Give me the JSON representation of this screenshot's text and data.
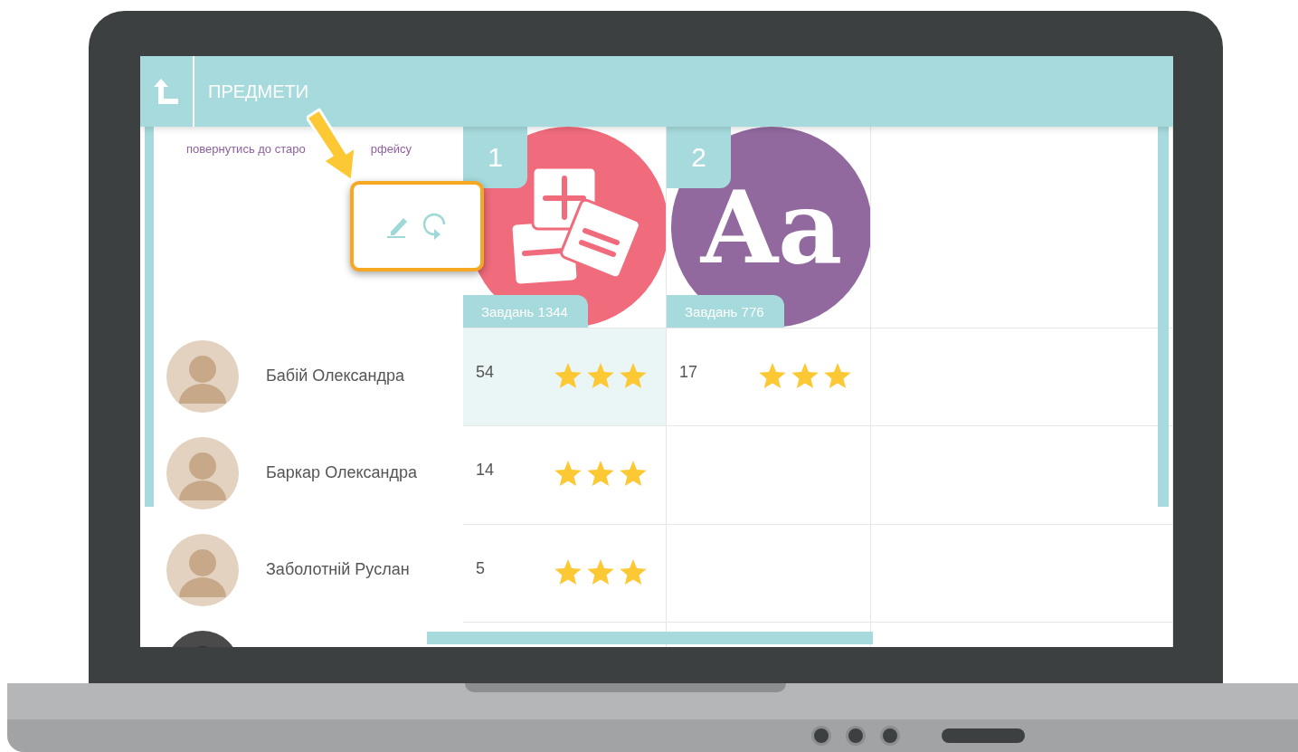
{
  "header": {
    "title": "ПРЕДМЕТИ"
  },
  "old_interface_link": {
    "parts": [
      "повернутись до старо",
      "рфейсу"
    ]
  },
  "subjects": [
    {
      "kind": "math",
      "number": "1",
      "tasks_label": "Завдань 1344",
      "color": "#f06b7b"
    },
    {
      "kind": "language",
      "number": "2",
      "tasks_label": "Завдань 776",
      "color": "#91699e",
      "icon_text": "Aa"
    }
  ],
  "students": [
    {
      "kind": "full",
      "name": "Бабій Олександра",
      "scores": [
        {
          "value": "54",
          "stars": 3,
          "selected": true
        },
        {
          "value": "17",
          "stars": 3,
          "selected": false
        }
      ]
    },
    {
      "kind": "full",
      "name": "Баркар Олександра",
      "scores": [
        {
          "value": "14",
          "stars": 3,
          "selected": false
        }
      ]
    },
    {
      "kind": "full",
      "name": "Заболотній Руслан",
      "scores": [
        {
          "value": "5",
          "stars": 3,
          "selected": false
        }
      ]
    },
    {
      "kind": "cut_off"
    }
  ]
}
